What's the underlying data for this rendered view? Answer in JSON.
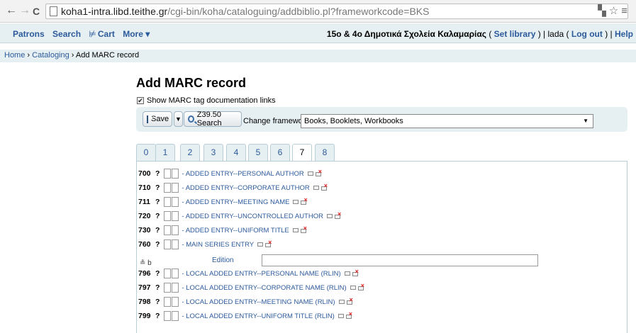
{
  "browser": {
    "back": "←",
    "forward": "→",
    "reload": "C",
    "url_host": "koha1-intra.libd.teithe.gr",
    "url_path": "/cgi-bin/koha/cataloguing/addbiblio.pl?frameworkcode=BKS",
    "right_icons": "▚☆≡"
  },
  "topnav": {
    "patrons": "Patrons",
    "search": "Search",
    "cart": "Cart",
    "cart_icon": "⊭",
    "more": "More ▾",
    "library": "15ο & 4ο Δημοτικά Σχολεία Καλαμαρίας",
    "set_library": "Set library",
    "user": "lada",
    "logout": "Log out",
    "help": "Help"
  },
  "breadcrumbs": {
    "home": "Home",
    "cataloging": "Cataloging",
    "current": "Add MARC record",
    "sep": "›"
  },
  "page": {
    "title": "Add MARC record",
    "show_doc_label": "Show MARC tag documentation links",
    "show_doc_checked": true
  },
  "toolbar": {
    "save": "Save",
    "z3950": "Z39.50 Search",
    "change_framework_label": "Change framework:",
    "framework_selected": "Books, Booklets, Workbooks"
  },
  "tabs": [
    "0",
    "1",
    "2",
    "3",
    "4",
    "5",
    "6",
    "7",
    "8"
  ],
  "active_tab": "7",
  "fields": [
    {
      "tag": "700",
      "desc": "ADDED ENTRY--PERSONAL AUTHOR"
    },
    {
      "tag": "710",
      "desc": "ADDED ENTRY--CORPORATE AUTHOR"
    },
    {
      "tag": "711",
      "desc": "ADDED ENTRY--MEETING NAME"
    },
    {
      "tag": "720",
      "desc": "ADDED ENTRY--UNCONTROLLED AUTHOR"
    },
    {
      "tag": "730",
      "desc": "ADDED ENTRY--UNIFORM TITLE"
    },
    {
      "tag": "760",
      "desc": "MAIN SERIES ENTRY"
    },
    {
      "tag": "796",
      "desc": "LOCAL ADDED ENTRY--PERSONAL NAME (RLIN)"
    },
    {
      "tag": "797",
      "desc": "LOCAL ADDED ENTRY--CORPORATE NAME (RLIN)"
    },
    {
      "tag": "798",
      "desc": "LOCAL ADDED ENTRY--MEETING NAME (RLIN)"
    },
    {
      "tag": "799",
      "desc": "LOCAL ADDED ENTRY--UNIFORM TITLE (RLIN)"
    }
  ],
  "subfield": {
    "code": "≗ b",
    "label": "Edition",
    "value": ""
  },
  "q_mark": "?",
  "dash": "-"
}
